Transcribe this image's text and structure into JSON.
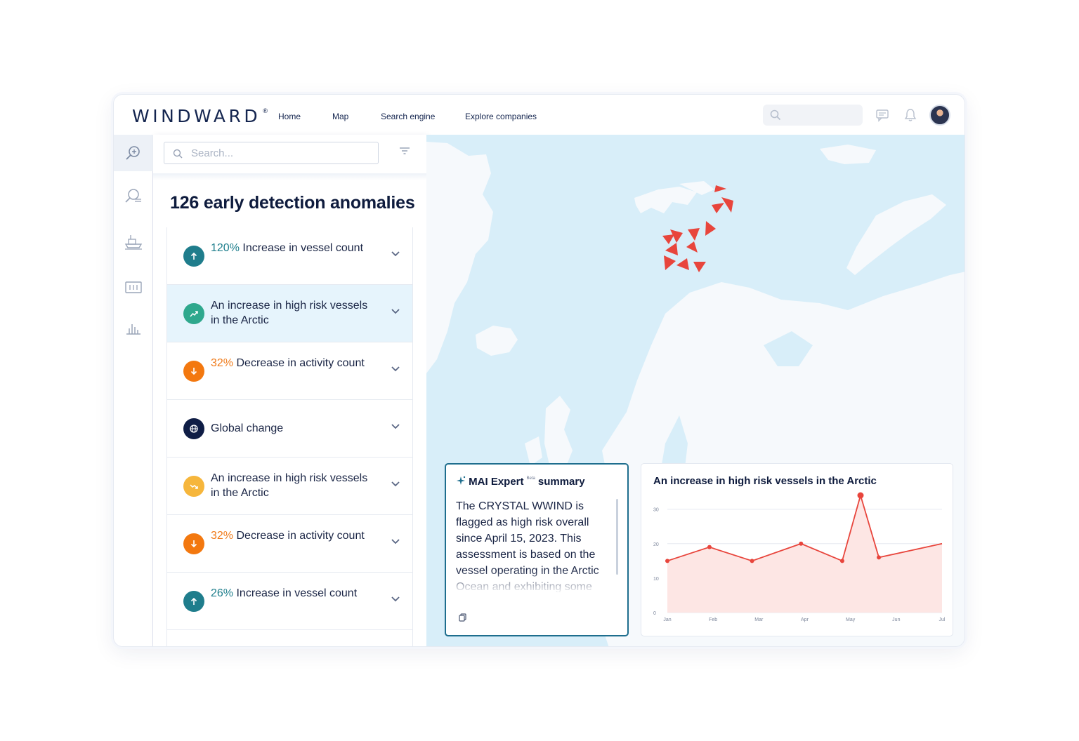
{
  "brand": {
    "name": "WINDWARD",
    "mark": "®"
  },
  "nav": {
    "items": [
      "Home",
      "Map",
      "Search engine",
      "Explore companies"
    ]
  },
  "header": {
    "search_placeholder": ""
  },
  "panel": {
    "search_placeholder": "Search...",
    "title": "126 early detection anomalies",
    "items": [
      {
        "pct": "120%",
        "text": "Increase in vessel count",
        "trend": "up",
        "icon": "arrow-up-icon",
        "color": "#1f7d8c"
      },
      {
        "pct": "",
        "text": "An increase in high risk vessels in the Arctic",
        "trend": "trend",
        "icon": "trend-up-icon",
        "color": "#2fa88d",
        "selected": true
      },
      {
        "pct": "32%",
        "text": "Decrease in activity count",
        "trend": "down",
        "icon": "arrow-down-icon",
        "color": "#f3780f"
      },
      {
        "pct": "",
        "text": "Global change",
        "trend": "global",
        "icon": "globe-icon",
        "color": "#0f1d45"
      },
      {
        "pct": "",
        "text": "An increase in high risk vessels in the Arctic",
        "trend": "trend",
        "icon": "trend-icon",
        "color": "#f6b63c"
      },
      {
        "pct": "32%",
        "text": "Decrease in activity count",
        "trend": "down",
        "icon": "arrow-down-icon",
        "color": "#f3780f"
      },
      {
        "pct": "26%",
        "text": "Increase in vessel count",
        "trend": "up",
        "icon": "arrow-up-icon",
        "color": "#1f7d8c"
      }
    ]
  },
  "mai": {
    "title_a": "MAI Expert",
    "beta": "Beta",
    "title_b": "summary",
    "body": "The CRYSTAL WWIND is flagged as high risk overall since April 15, 2023. This assessment is based on the vessel operating in the Arctic Ocean and exhibiting some"
  },
  "chart_data": {
    "type": "area",
    "title": "An increase in high risk vessels in the Arctic",
    "x": [
      "Jan",
      "Feb",
      "Mar",
      "Apr",
      "May",
      "Jun",
      "Jul"
    ],
    "points": [
      {
        "x": 0.0,
        "y": 15
      },
      {
        "x": 0.92,
        "y": 19
      },
      {
        "x": 1.85,
        "y": 15
      },
      {
        "x": 2.92,
        "y": 20
      },
      {
        "x": 3.82,
        "y": 15
      },
      {
        "x": 4.22,
        "y": 34
      },
      {
        "x": 4.62,
        "y": 16
      },
      {
        "x": 6.0,
        "y": 20
      }
    ],
    "yticks": [
      0,
      10,
      20,
      30
    ],
    "ylim": [
      0,
      34
    ],
    "grid": true,
    "line_color": "#e8453c",
    "fill_color": "#fde6e4"
  },
  "colors": {
    "accent": "#1e6e8e",
    "vessel": "#e8453c",
    "land": "#f6f9fc",
    "sea": "#d8eef9"
  }
}
